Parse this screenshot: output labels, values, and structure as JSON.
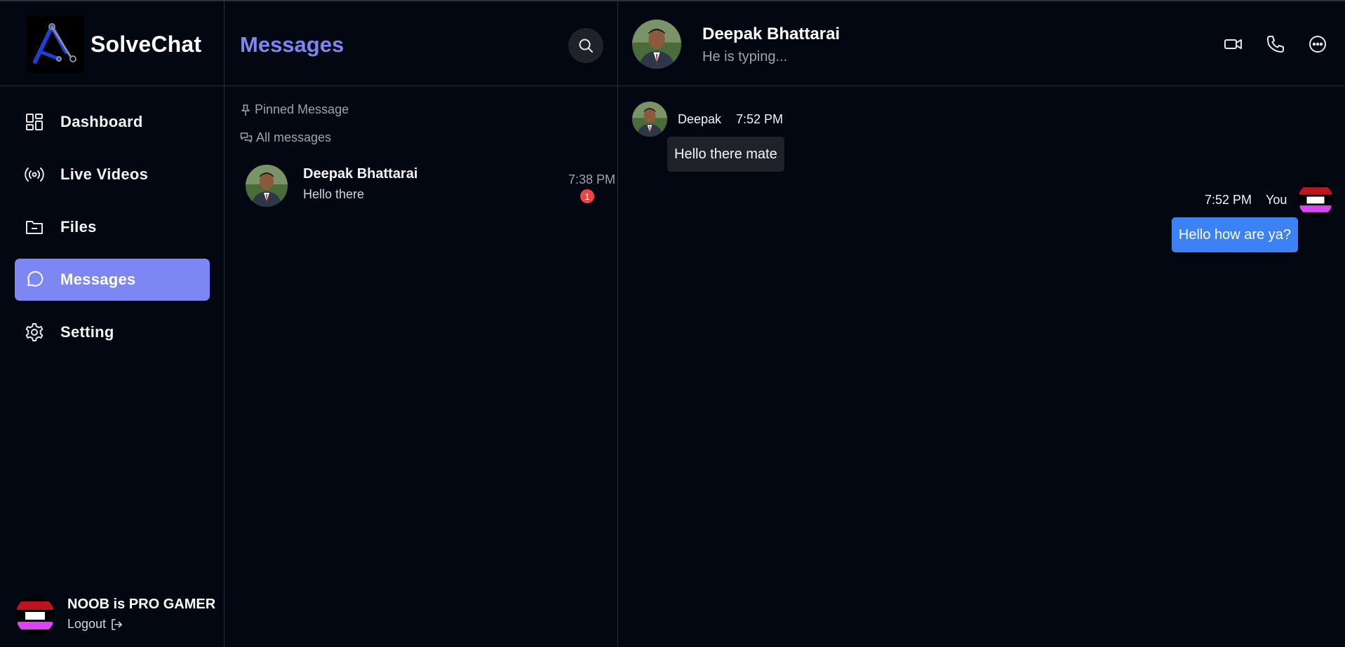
{
  "brand": {
    "name": "SolveChat"
  },
  "nav": {
    "items": [
      {
        "label": "Dashboard",
        "icon": "dashboard-icon"
      },
      {
        "label": "Live Videos",
        "icon": "broadcast-icon"
      },
      {
        "label": "Files",
        "icon": "folder-icon"
      },
      {
        "label": "Messages",
        "icon": "message-circle-icon",
        "active": true
      },
      {
        "label": "Setting",
        "icon": "gear-icon"
      }
    ]
  },
  "user": {
    "name": "NOOB is PRO GAMER",
    "logout_label": "Logout"
  },
  "messages_panel": {
    "title": "Messages",
    "pinned_label": "Pinned Message",
    "all_label": "All messages",
    "conversations": [
      {
        "name": "Deepak Bhattarai",
        "preview": "Hello there",
        "time": "7:38 PM",
        "unread": "1"
      }
    ]
  },
  "chat": {
    "contact_name": "Deepak Bhattarai",
    "status": "He is typing...",
    "messages": [
      {
        "sender": "Deepak",
        "time": "7:52 PM",
        "text": "Hello there mate",
        "direction": "in"
      },
      {
        "sender": "You",
        "time": "7:52 PM",
        "text": "Hello how are ya?",
        "direction": "out"
      }
    ]
  },
  "colors": {
    "accent": "#7c87f3",
    "outgoing": "#3b82f6",
    "badge": "#ef4444",
    "background": "#030712"
  }
}
